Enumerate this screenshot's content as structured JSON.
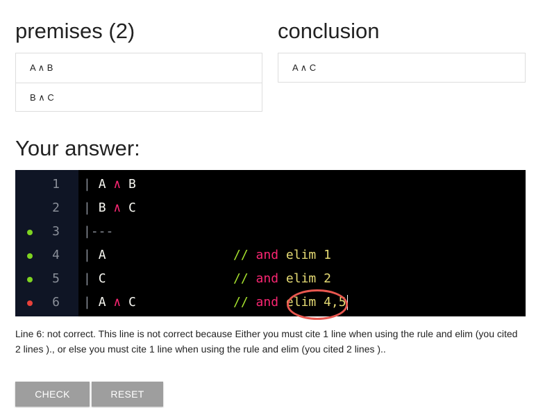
{
  "premises": {
    "title": "premises (2)",
    "items": [
      "A ∧ B",
      "B ∧ C"
    ]
  },
  "conclusion": {
    "title": "conclusion",
    "items": [
      "A ∧ C"
    ]
  },
  "answer": {
    "title": "Your answer:"
  },
  "editor": {
    "lines": [
      {
        "num": "1",
        "status": "none",
        "bar": "|",
        "code": [
          {
            "t": "A ",
            "c": "text"
          },
          {
            "t": "∧",
            "c": "op"
          },
          {
            "t": " B",
            "c": "text"
          }
        ],
        "comment": null
      },
      {
        "num": "2",
        "status": "none",
        "bar": "|",
        "code": [
          {
            "t": "B ",
            "c": "text"
          },
          {
            "t": "∧",
            "c": "op"
          },
          {
            "t": " C",
            "c": "text"
          }
        ],
        "comment": null
      },
      {
        "num": "3",
        "status": "ok",
        "bar": "|---",
        "code": [],
        "comment": null
      },
      {
        "num": "4",
        "status": "ok",
        "bar": "|",
        "code": [
          {
            "t": "A",
            "c": "text"
          }
        ],
        "comment": {
          "slash": "//",
          "kw": "and",
          "rule": "elim",
          "refs": "1"
        }
      },
      {
        "num": "5",
        "status": "ok",
        "bar": "|",
        "code": [
          {
            "t": "C",
            "c": "text"
          }
        ],
        "comment": {
          "slash": "//",
          "kw": "and",
          "rule": "elim",
          "refs": "2"
        }
      },
      {
        "num": "6",
        "status": "error",
        "bar": "|",
        "code": [
          {
            "t": "A ",
            "c": "text"
          },
          {
            "t": "∧",
            "c": "op"
          },
          {
            "t": " C",
            "c": "text"
          }
        ],
        "comment": {
          "slash": "//",
          "kw": "and",
          "rule": "elim",
          "refs": "4,5"
        }
      }
    ],
    "status_colors": {
      "ok": "#7ed321",
      "error": "#e8413a"
    }
  },
  "feedback": {
    "text": "Line 6: not correct. This line is not correct because Either you must cite 1 line when using the rule and elim (you cited 2 lines )., or else you must cite 1 line when using the rule and elim (you cited 2 lines ).."
  },
  "buttons": {
    "check": "CHECK",
    "reset": "RESET"
  }
}
